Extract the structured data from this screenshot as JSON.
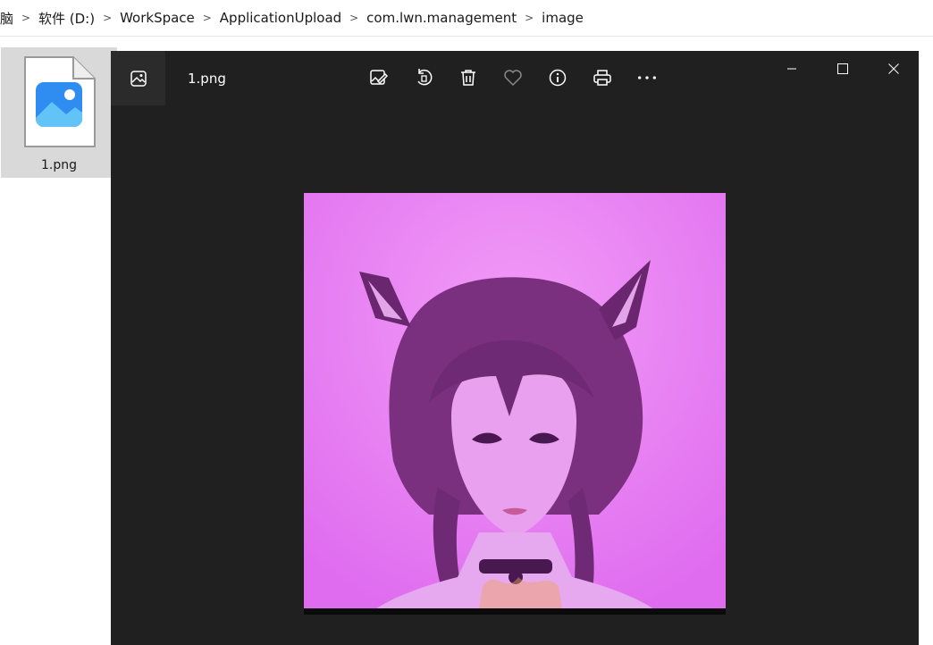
{
  "breadcrumb": {
    "items": [
      "脑",
      "软件 (D:)",
      "WorkSpace",
      "ApplicationUpload",
      "com.lwn.management",
      "image"
    ],
    "separator": ">"
  },
  "explorer": {
    "file": {
      "name": "1.png",
      "icon": "image-file-icon"
    }
  },
  "viewer": {
    "title": "1.png",
    "app_icon": "photos-app-icon",
    "toolbar": [
      "edit-image-icon",
      "rotate-icon",
      "delete-icon",
      "favorite-icon",
      "info-icon",
      "print-icon",
      "more-icon"
    ],
    "window_controls": [
      "minimize-icon",
      "maximize-icon",
      "close-icon"
    ],
    "colors": {
      "background": "#202020",
      "photo_tint": "#e879f6"
    }
  }
}
